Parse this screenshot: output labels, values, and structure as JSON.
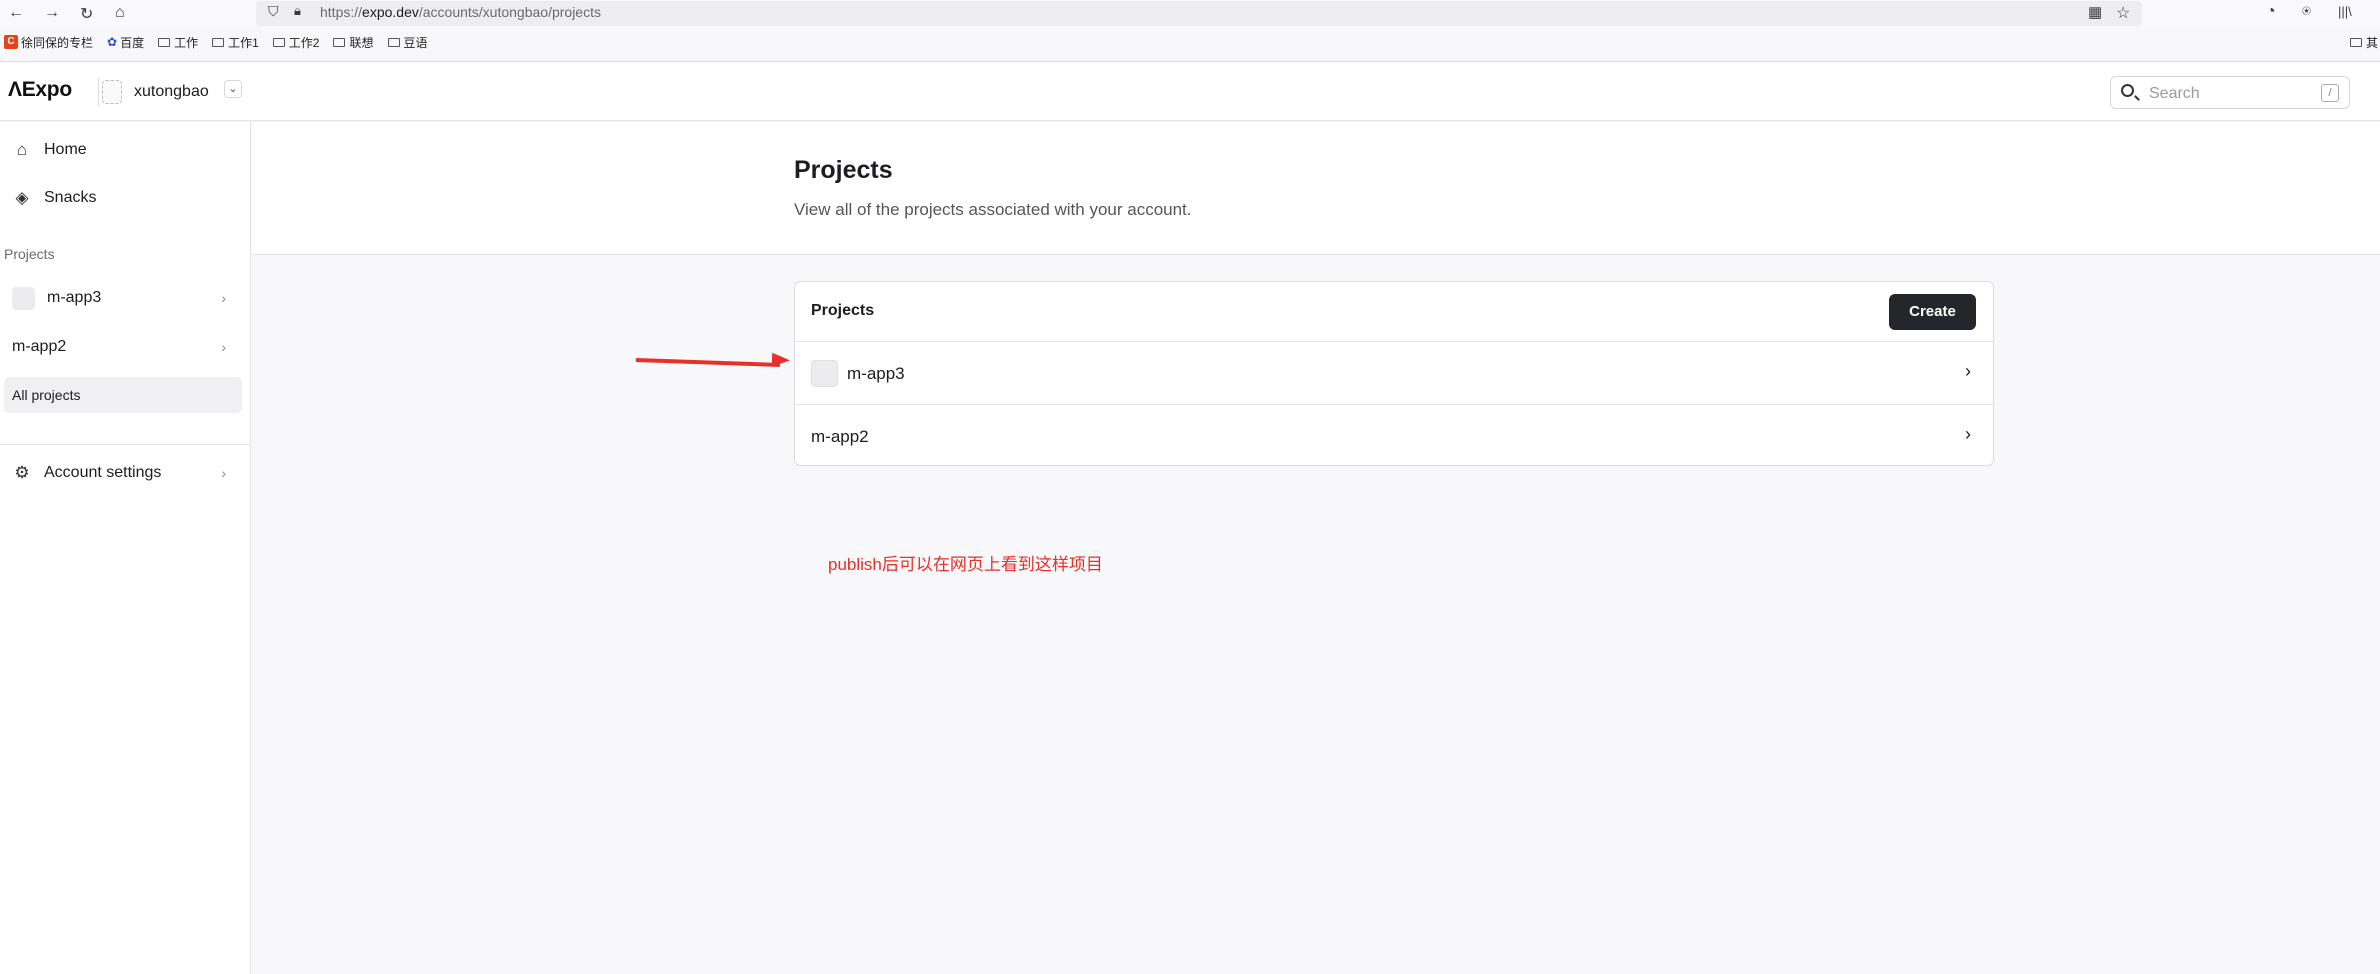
{
  "browser": {
    "url_prefix": "https://",
    "url_host": "expo.dev",
    "url_path": "/accounts/xutongbao/projects",
    "bookmarks": [
      {
        "label": "徐同保的专栏",
        "icon": "csdn-logo-icon"
      },
      {
        "label": "百度",
        "icon": "baidu-paw-icon"
      },
      {
        "label": "工作",
        "icon": "folder-icon"
      },
      {
        "label": "工作1",
        "icon": "folder-icon"
      },
      {
        "label": "工作2",
        "icon": "folder-icon"
      },
      {
        "label": "联想",
        "icon": "folder-icon"
      },
      {
        "label": "豆语",
        "icon": "folder-icon"
      }
    ],
    "bookmark_overflow": "其"
  },
  "header": {
    "logo": "Expo",
    "account_name": "xutongbao",
    "search_placeholder": "Search",
    "search_shortcut": "/"
  },
  "sidebar": {
    "home": "Home",
    "snacks": "Snacks",
    "section_projects": "Projects",
    "projects": [
      "m-app3",
      "m-app2"
    ],
    "all_projects": "All projects",
    "account_settings": "Account settings"
  },
  "main": {
    "title": "Projects",
    "subtitle": "View all of the projects associated with your account.",
    "card_title": "Projects",
    "create_label": "Create",
    "rows": [
      "m-app3",
      "m-app2"
    ]
  },
  "annotation": {
    "note": "publish后可以在网页上看到这样项目",
    "color": "#e8302a"
  }
}
